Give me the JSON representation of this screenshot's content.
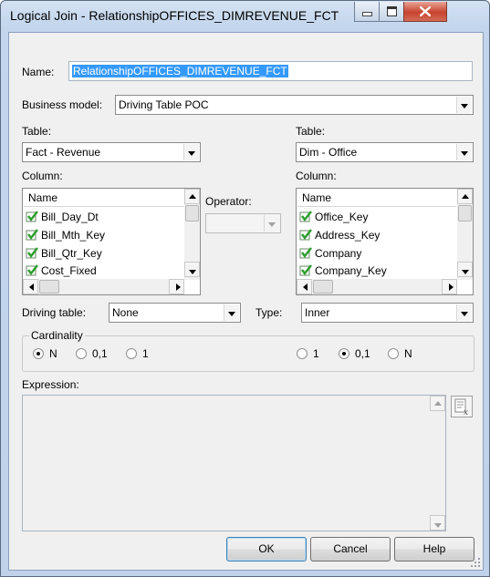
{
  "window": {
    "title": "Logical Join - RelationshipOFFICES_DIMREVENUE_FCT"
  },
  "name": {
    "label": "Name:",
    "value": "RelationshipOFFICES_DIMREVENUE_FCT"
  },
  "business_model": {
    "label": "Business model:",
    "value": "Driving Table POC"
  },
  "left": {
    "table_label": "Table:",
    "table_value": "Fact - Revenue",
    "column_label": "Column:",
    "list_header": "Name",
    "columns": [
      "Bill_Day_Dt",
      "Bill_Mth_Key",
      "Bill_Qtr_Key",
      "Cost_Fixed"
    ]
  },
  "right": {
    "table_label": "Table:",
    "table_value": "Dim - Office",
    "column_label": "Column:",
    "list_header": "Name",
    "columns": [
      "Office_Key",
      "Address_Key",
      "Company",
      "Company_Key"
    ]
  },
  "operator": {
    "label": "Operator:",
    "value": ""
  },
  "driving_table": {
    "label": "Driving table:",
    "value": "None"
  },
  "type": {
    "label": "Type:",
    "value": "Inner"
  },
  "cardinality": {
    "label": "Cardinality",
    "left_options": [
      "N",
      "0,1",
      "1"
    ],
    "left_selected": "N",
    "right_options": [
      "1",
      "0,1",
      "N"
    ],
    "right_selected": "0,1"
  },
  "expression": {
    "label": "Expression:",
    "value": ""
  },
  "buttons": {
    "ok": "OK",
    "cancel": "Cancel",
    "help": "Help"
  },
  "icons": {
    "minimize": "minimize-icon",
    "maximize": "maximize-icon",
    "close": "close-icon",
    "check": "green-check-icon",
    "expression_builder": "expression-builder-icon"
  },
  "colors": {
    "selection": "#3399ff",
    "check": "#2e9e2e",
    "close_button": "#c7432e"
  }
}
